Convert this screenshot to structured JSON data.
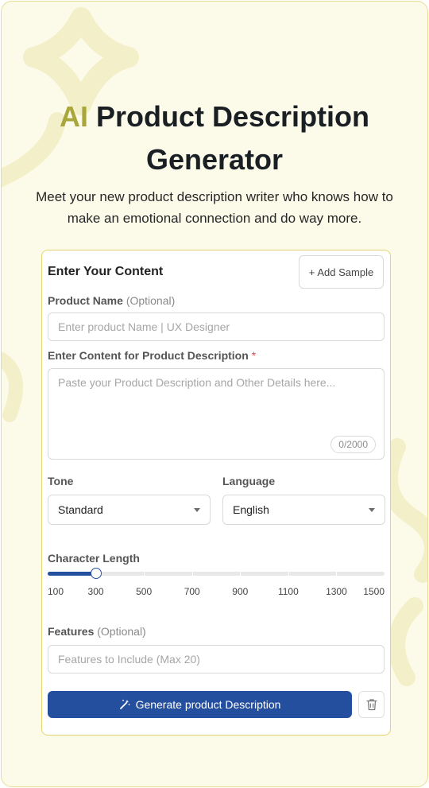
{
  "hero": {
    "title_accent": "AI",
    "title_rest": "Product Description",
    "title_line2": "Generator",
    "subtitle": "Meet your new product description writer who knows how to make an emotional connection and do way more."
  },
  "form": {
    "card_title": "Enter Your Content",
    "add_sample_label": "Add Sample",
    "add_sample_prefix": "+",
    "product_name": {
      "label": "Product Name",
      "optional": "(Optional)",
      "placeholder": "Enter product Name | UX Designer",
      "value": ""
    },
    "content": {
      "label": "Enter Content for Product Description",
      "required_mark": "*",
      "placeholder": "Paste your Product Description and Other Details here...",
      "counter": "0/2000"
    },
    "tone": {
      "label": "Tone",
      "value": "Standard"
    },
    "language": {
      "label": "Language",
      "value": "English"
    },
    "char_length": {
      "label": "Character Length",
      "ticks": [
        "100",
        "300",
        "500",
        "700",
        "900",
        "1100",
        "1300",
        "1500"
      ],
      "value": 300,
      "min": 100,
      "max": 1500
    },
    "features": {
      "label": "Features",
      "optional": "(Optional)",
      "placeholder": "Features to Include (Max 20)",
      "value": ""
    },
    "generate_label": "Generate product Description",
    "icons": {
      "generate": "magic-wand-icon",
      "clear": "trash-icon",
      "dropdown": "caret-down-icon"
    }
  },
  "colors": {
    "accent_olive": "#a9a63c",
    "primary_blue": "#244f9e",
    "background": "#fcfbea",
    "card_border": "#e6d36b",
    "required": "#e04848"
  }
}
